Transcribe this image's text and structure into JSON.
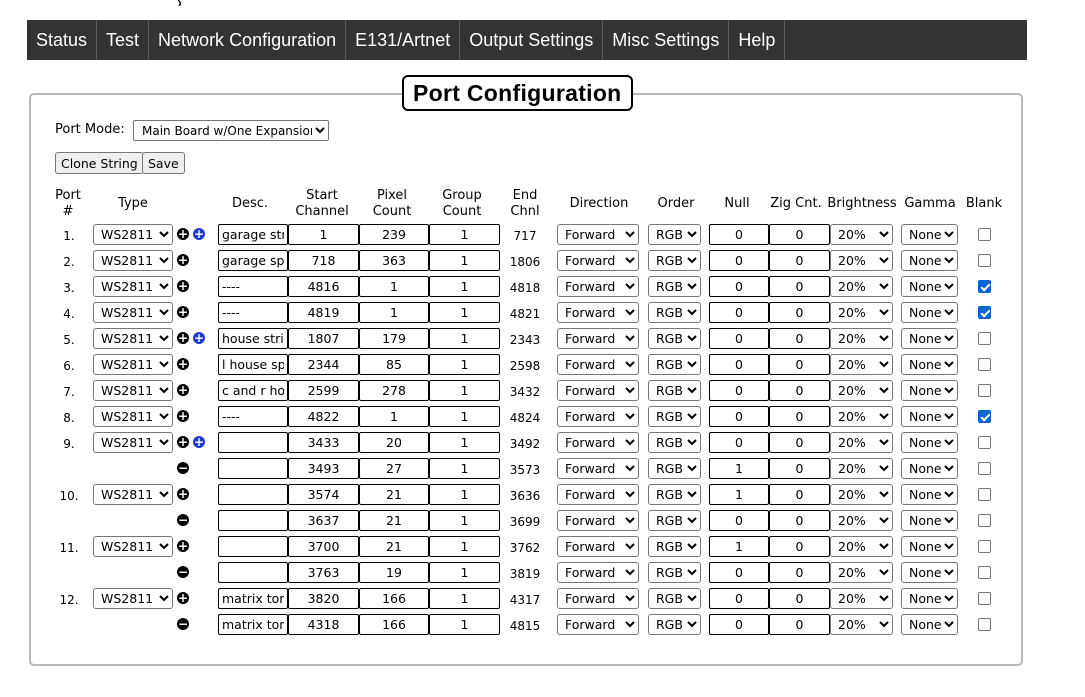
{
  "nav": {
    "items": [
      {
        "label": "Status"
      },
      {
        "label": "Test"
      },
      {
        "label": "Network Configuration"
      },
      {
        "label": "E131/Artnet"
      },
      {
        "label": "Output Settings"
      },
      {
        "label": "Misc Settings"
      },
      {
        "label": "Help"
      }
    ]
  },
  "section": {
    "title": "Port Configuration"
  },
  "port_mode": {
    "label": "Port Mode:",
    "value": "Main Board w/One Expansion"
  },
  "buttons": {
    "clone": "Clone String",
    "save": "Save"
  },
  "columns": {
    "port": "Port\n#",
    "type": "Type",
    "desc": "Desc.",
    "start": "Start\nChannel",
    "pixel": "Pixel\nCount",
    "group": "Group\nCount",
    "end": "End\nChnl",
    "direction": "Direction",
    "order": "Order",
    "null": "Null",
    "zig": "Zig Cnt.",
    "brightness": "Brightness",
    "gamma": "Gamma",
    "blank": "Blank"
  },
  "rows": [
    {
      "port": "1.",
      "type": "WS2811",
      "icons": [
        "plus",
        "plus-blue"
      ],
      "desc": "garage string",
      "start": "1",
      "pixel": "239",
      "group": "1",
      "end": "717",
      "direction": "Forward",
      "order": "RGB",
      "null": "0",
      "zig": "0",
      "brightness": "20%",
      "gamma": "None",
      "blank": false
    },
    {
      "port": "2.",
      "type": "WS2811",
      "icons": [
        "plus"
      ],
      "desc": "garage spiral",
      "start": "718",
      "pixel": "363",
      "group": "1",
      "end": "1806",
      "direction": "Forward",
      "order": "RGB",
      "null": "0",
      "zig": "0",
      "brightness": "20%",
      "gamma": "None",
      "blank": false
    },
    {
      "port": "3.",
      "type": "WS2811",
      "icons": [
        "plus"
      ],
      "desc": "----",
      "start": "4816",
      "pixel": "1",
      "group": "1",
      "end": "4818",
      "direction": "Forward",
      "order": "RGB",
      "null": "0",
      "zig": "0",
      "brightness": "20%",
      "gamma": "None",
      "blank": true
    },
    {
      "port": "4.",
      "type": "WS2811",
      "icons": [
        "plus"
      ],
      "desc": "----",
      "start": "4819",
      "pixel": "1",
      "group": "1",
      "end": "4821",
      "direction": "Forward",
      "order": "RGB",
      "null": "0",
      "zig": "0",
      "brightness": "20%",
      "gamma": "None",
      "blank": true
    },
    {
      "port": "5.",
      "type": "WS2811",
      "icons": [
        "plus",
        "plus-blue"
      ],
      "desc": "house string",
      "start": "1807",
      "pixel": "179",
      "group": "1",
      "end": "2343",
      "direction": "Forward",
      "order": "RGB",
      "null": "0",
      "zig": "0",
      "brightness": "20%",
      "gamma": "None",
      "blank": false
    },
    {
      "port": "6.",
      "type": "WS2811",
      "icons": [
        "plus"
      ],
      "desc": "l house spiral",
      "start": "2344",
      "pixel": "85",
      "group": "1",
      "end": "2598",
      "direction": "Forward",
      "order": "RGB",
      "null": "0",
      "zig": "0",
      "brightness": "20%",
      "gamma": "None",
      "blank": false
    },
    {
      "port": "7.",
      "type": "WS2811",
      "icons": [
        "plus"
      ],
      "desc": "c and r house",
      "start": "2599",
      "pixel": "278",
      "group": "1",
      "end": "3432",
      "direction": "Forward",
      "order": "RGB",
      "null": "0",
      "zig": "0",
      "brightness": "20%",
      "gamma": "None",
      "blank": false
    },
    {
      "port": "8.",
      "type": "WS2811",
      "icons": [
        "plus"
      ],
      "desc": "----",
      "start": "4822",
      "pixel": "1",
      "group": "1",
      "end": "4824",
      "direction": "Forward",
      "order": "RGB",
      "null": "0",
      "zig": "0",
      "brightness": "20%",
      "gamma": "None",
      "blank": true
    },
    {
      "port": "9.",
      "type": "WS2811",
      "icons": [
        "plus",
        "plus-blue"
      ],
      "desc": "",
      "start": "3433",
      "pixel": "20",
      "group": "1",
      "end": "3492",
      "direction": "Forward",
      "order": "RGB",
      "null": "0",
      "zig": "0",
      "brightness": "20%",
      "gamma": "None",
      "blank": false
    },
    {
      "port": "",
      "type": null,
      "icons": [
        "minus"
      ],
      "desc": "",
      "start": "3493",
      "pixel": "27",
      "group": "1",
      "end": "3573",
      "direction": "Forward",
      "order": "RGB",
      "null": "1",
      "zig": "0",
      "brightness": "20%",
      "gamma": "None",
      "blank": false
    },
    {
      "port": "10.",
      "type": "WS2811",
      "icons": [
        "plus"
      ],
      "desc": "",
      "start": "3574",
      "pixel": "21",
      "group": "1",
      "end": "3636",
      "direction": "Forward",
      "order": "RGB",
      "null": "1",
      "zig": "0",
      "brightness": "20%",
      "gamma": "None",
      "blank": false
    },
    {
      "port": "",
      "type": null,
      "icons": [
        "minus"
      ],
      "desc": "",
      "start": "3637",
      "pixel": "21",
      "group": "1",
      "end": "3699",
      "direction": "Forward",
      "order": "RGB",
      "null": "0",
      "zig": "0",
      "brightness": "20%",
      "gamma": "None",
      "blank": false
    },
    {
      "port": "11.",
      "type": "WS2811",
      "icons": [
        "plus"
      ],
      "desc": "",
      "start": "3700",
      "pixel": "21",
      "group": "1",
      "end": "3762",
      "direction": "Forward",
      "order": "RGB",
      "null": "1",
      "zig": "0",
      "brightness": "20%",
      "gamma": "None",
      "blank": false
    },
    {
      "port": "",
      "type": null,
      "icons": [
        "minus"
      ],
      "desc": "",
      "start": "3763",
      "pixel": "19",
      "group": "1",
      "end": "3819",
      "direction": "Forward",
      "order": "RGB",
      "null": "0",
      "zig": "0",
      "brightness": "20%",
      "gamma": "None",
      "blank": false
    },
    {
      "port": "12.",
      "type": "WS2811",
      "icons": [
        "plus"
      ],
      "desc": "matrix tomb",
      "start": "3820",
      "pixel": "166",
      "group": "1",
      "end": "4317",
      "direction": "Forward",
      "order": "RGB",
      "null": "0",
      "zig": "0",
      "brightness": "20%",
      "gamma": "None",
      "blank": false
    },
    {
      "port": "",
      "type": null,
      "icons": [
        "minus"
      ],
      "desc": "matrix tomb",
      "start": "4318",
      "pixel": "166",
      "group": "1",
      "end": "4815",
      "direction": "Forward",
      "order": "RGB",
      "null": "0",
      "zig": "0",
      "brightness": "20%",
      "gamma": "None",
      "blank": false
    }
  ],
  "icons": {
    "plus": "plus-circle-icon",
    "plus-blue": "plus-circle-blue-icon",
    "minus": "minus-circle-icon"
  },
  "colors": {
    "navbar": "#333333",
    "nav_text": "#ffffff",
    "checkbox_on": "#0a64d6",
    "plus_blue": "#1a3bd6"
  }
}
